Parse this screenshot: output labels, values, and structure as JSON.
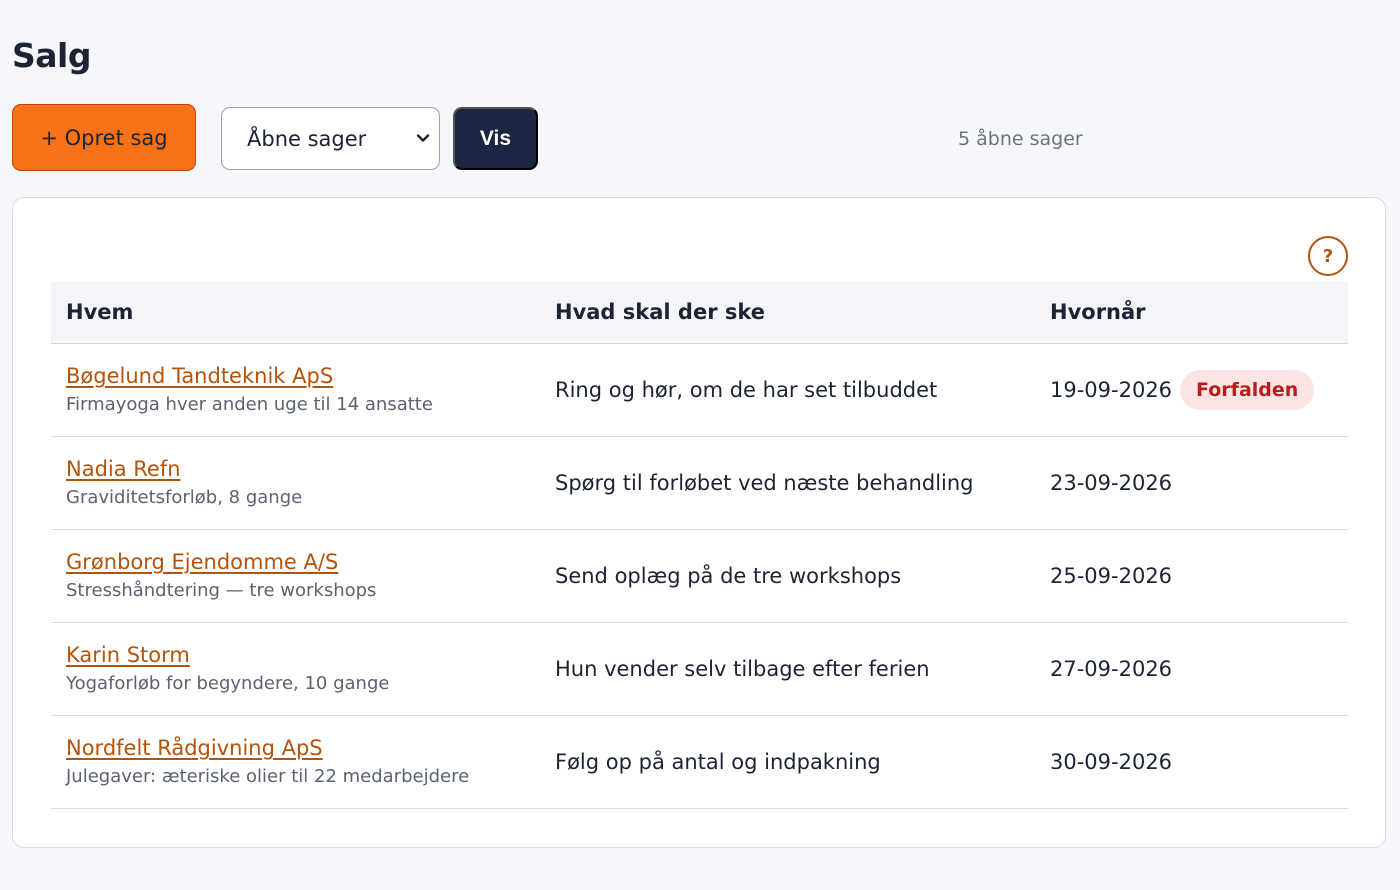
{
  "page": {
    "title": "Salg"
  },
  "toolbar": {
    "create_label": "+ Opret sag",
    "filter_selected": "Åbne sager",
    "show_label": "Vis",
    "count_text": "5 åbne sager"
  },
  "help": {
    "label": "?"
  },
  "table": {
    "headers": [
      "Hvem",
      "Hvad skal der ske",
      "Hvornår"
    ],
    "rows": [
      {
        "name": "Bøgelund Tandteknik ApS",
        "description": "Firmayoga hver anden uge til 14 ansatte",
        "action": "Ring og hør, om de har set tilbuddet",
        "date": "19-09-2026",
        "badge": "Forfalden"
      },
      {
        "name": "Nadia Refn",
        "description": "Graviditetsforløb, 8 gange",
        "action": "Spørg til forløbet ved næste behandling",
        "date": "23-09-2026",
        "badge": ""
      },
      {
        "name": "Grønborg Ejendomme A/S",
        "description": "Stresshåndtering — tre workshops",
        "action": "Send oplæg på de tre workshops",
        "date": "25-09-2026",
        "badge": ""
      },
      {
        "name": "Karin Storm",
        "description": "Yogaforløb for begyndere, 10 gange",
        "action": "Hun vender selv tilbage efter ferien",
        "date": "27-09-2026",
        "badge": ""
      },
      {
        "name": "Nordfelt Rådgivning ApS",
        "description": "Julegaver: æteriske olier til 22 medarbejdere",
        "action": "Følg op på antal og indpakning",
        "date": "30-09-2026",
        "badge": ""
      }
    ]
  },
  "colors": {
    "accent": "#f97316",
    "link": "#b45309",
    "dark_button": "#1c2541",
    "badge_bg": "#fde4e4",
    "badge_text": "#b91c1c"
  },
  "icons": {
    "select_arrow": "chevron-down-icon",
    "help": "help-icon"
  }
}
